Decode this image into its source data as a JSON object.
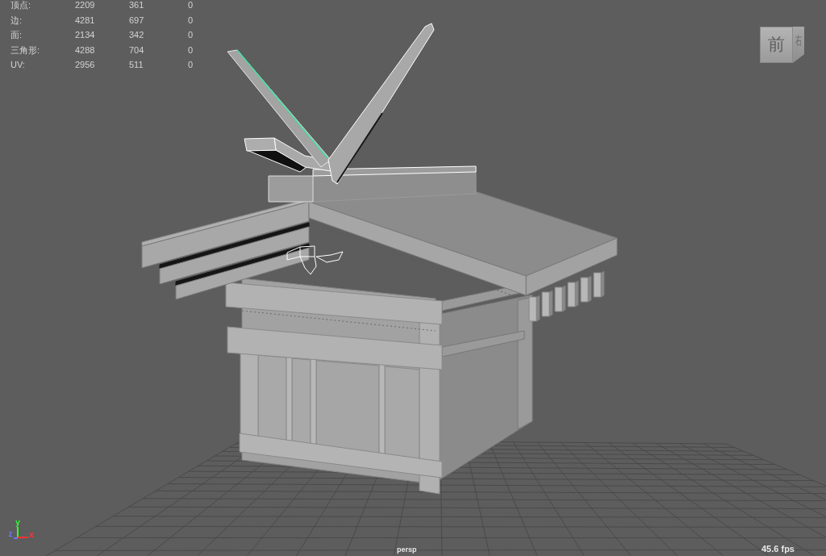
{
  "hud_stats": {
    "rows": [
      {
        "label": "顶点:",
        "values": [
          "2209",
          "361",
          "0"
        ]
      },
      {
        "label": "边:",
        "values": [
          "4281",
          "697",
          "0"
        ]
      },
      {
        "label": "面:",
        "values": [
          "2134",
          "342",
          "0"
        ]
      },
      {
        "label": "三角形:",
        "values": [
          "4288",
          "704",
          "0"
        ]
      },
      {
        "label": "UV:",
        "values": [
          "2956",
          "511",
          "0"
        ]
      }
    ]
  },
  "view_cube": {
    "front_label": "前",
    "right_label": "右"
  },
  "axis_indicator": {
    "axes": [
      {
        "kind": "y",
        "label": "y",
        "color": "#33ff33"
      },
      {
        "kind": "z",
        "label": "z",
        "color": "#6677ff"
      },
      {
        "kind": "x",
        "label": "x",
        "color": "#ff3333"
      }
    ]
  },
  "camera_label": "persp",
  "frame_rate": "45.6 fps"
}
